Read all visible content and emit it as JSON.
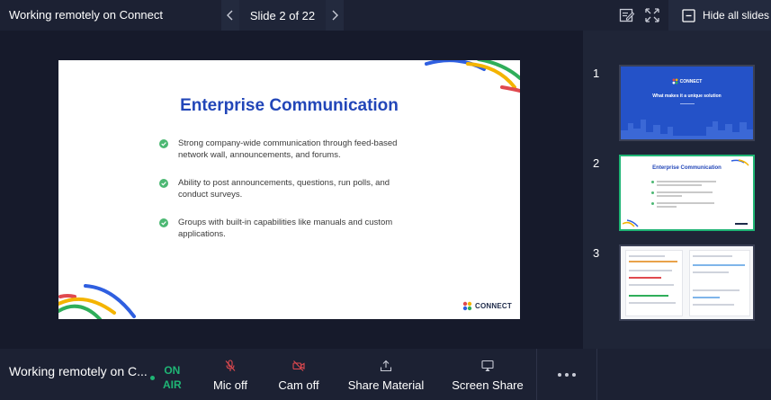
{
  "topbar": {
    "title": "Working remotely on Connect",
    "slide_counter": "Slide 2 of 22",
    "hide_all_label": "Hide all slides"
  },
  "slide": {
    "heading": "Enterprise Communication",
    "bullets": [
      "Strong company-wide communication through feed-based network wall, announcements, and forums.",
      "Ability to post announcements, questions, run polls, and conduct surveys.",
      "Groups with built-in capabilities like manuals and custom applications."
    ],
    "brand": "CONNECT"
  },
  "thumbnails": [
    {
      "number": "1",
      "brand": "CONNECT",
      "subtitle": "What makes it a unique solution"
    },
    {
      "number": "2",
      "title": "Enterprise Communication"
    },
    {
      "number": "3"
    }
  ],
  "bottombar": {
    "title": "Working remotely on C...",
    "on_air_line1": "ON",
    "on_air_line2": "AIR",
    "mic_label": "Mic off",
    "cam_label": "Cam off",
    "share_material_label": "Share Material",
    "screen_share_label": "Screen Share"
  },
  "colors": {
    "accent_green": "#1fb575",
    "off_red": "#e0494f",
    "heading_blue": "#2246b8"
  },
  "icons": [
    "chevron-left-icon",
    "chevron-right-icon",
    "notes-icon",
    "fullscreen-icon",
    "collapse-icon",
    "check-circle-icon",
    "mic-off-icon",
    "cam-off-icon",
    "share-material-icon",
    "screen-share-icon",
    "more-icon"
  ]
}
